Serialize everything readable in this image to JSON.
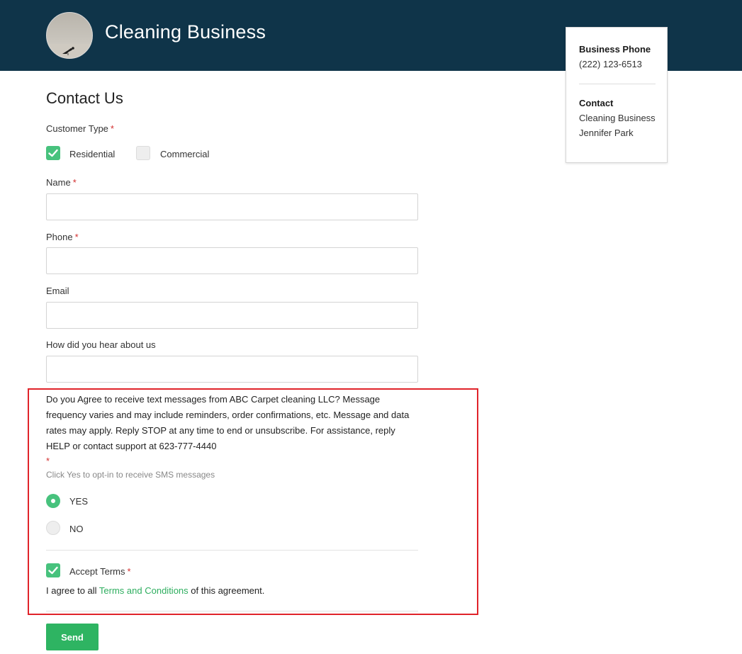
{
  "header": {
    "brand": "Cleaning Business",
    "avatar_icon": "seagull-photo-avatar",
    "background_color": "#0f3449"
  },
  "info_card": {
    "phone_label": "Business Phone",
    "phone_value": "(222) 123-6513",
    "contact_label": "Contact",
    "contact_company": "Cleaning Business",
    "contact_person": "Jennifer Park"
  },
  "form": {
    "title": "Contact Us",
    "customer_type": {
      "label": "Customer Type",
      "required_mark": "*",
      "options": [
        {
          "label": "Residential",
          "checked": true
        },
        {
          "label": "Commercial",
          "checked": false
        }
      ]
    },
    "name": {
      "label": "Name",
      "required_mark": "*",
      "value": ""
    },
    "phone": {
      "label": "Phone",
      "required_mark": "*",
      "value": ""
    },
    "email": {
      "label": "Email",
      "value": ""
    },
    "referral": {
      "label": "How did you hear about us",
      "value": ""
    },
    "sms_consent": {
      "text": "Do you Agree to receive text messages from ABC Carpet cleaning LLC? Message frequency varies and may include reminders, order confirmations, etc. Message and data rates may apply. Reply STOP at any time to end or unsubscribe. For assistance, reply HELP or contact support at 623-777-4440",
      "required_mark": "*",
      "hint": "Click Yes to opt-in to receive SMS messages",
      "options": [
        {
          "label": "YES",
          "selected": true
        },
        {
          "label": "NO",
          "selected": false
        }
      ]
    },
    "terms": {
      "label": "Accept Terms",
      "required_mark": "*",
      "checked": true,
      "text_before": "I agree to all ",
      "link_text": "Terms and Conditions",
      "text_after": " of this agreement."
    },
    "submit_label": "Send"
  },
  "colors": {
    "accent_green": "#47c27d",
    "link_green": "#2eae5f",
    "required_red": "#d32f2f",
    "highlight_red": "#e0232a"
  }
}
